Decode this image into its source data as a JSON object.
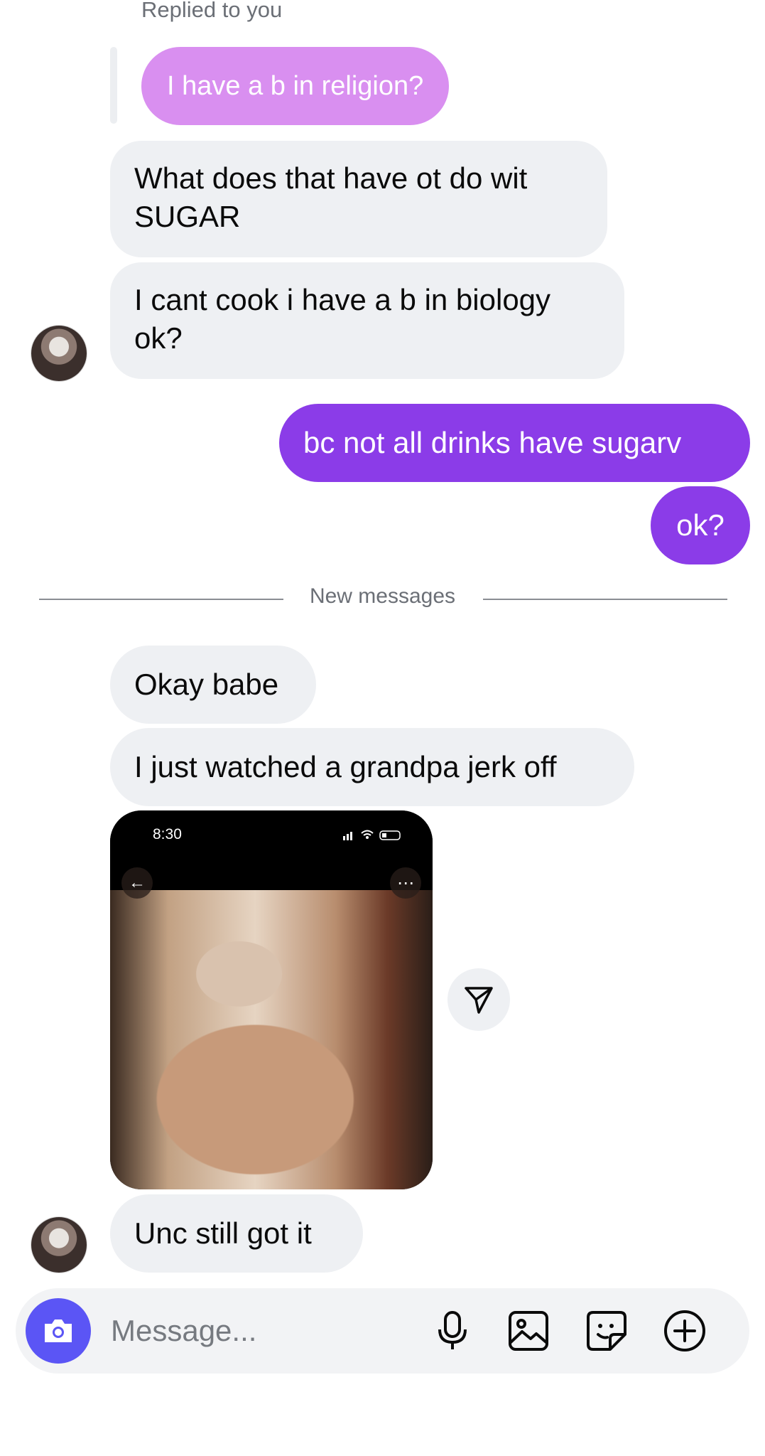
{
  "thread": {
    "reply_context": {
      "label": "Replied to you",
      "quoted_text": "I have a b in religion?"
    },
    "messages_before": [
      {
        "from": "them",
        "text": "What does that have ot do wit SUGAR"
      },
      {
        "from": "them",
        "text": "I cant cook i have a b in biology ok?"
      },
      {
        "from": "me",
        "text": "bc not all drinks have sugarv"
      },
      {
        "from": "me",
        "text": "ok?"
      }
    ],
    "divider": "New messages",
    "messages_after": [
      {
        "from": "them",
        "text": "Okay babe"
      },
      {
        "from": "them",
        "text": "I just watched a grandpa jerk off"
      },
      {
        "from": "them",
        "type": "media",
        "status_time": "8:30"
      },
      {
        "from": "them",
        "text": "Unc still got it"
      }
    ]
  },
  "composer": {
    "placeholder": "Message..."
  },
  "colors": {
    "outgoing": "#8b3ce8",
    "quoted_reply": "#d98ff0",
    "incoming": "#eef0f3",
    "camera_button": "#5b55f5"
  },
  "icons": [
    "camera-icon",
    "microphone-icon",
    "image-icon",
    "sticker-icon",
    "plus-circle-icon",
    "send-share-icon",
    "back-arrow-icon",
    "more-icon"
  ]
}
